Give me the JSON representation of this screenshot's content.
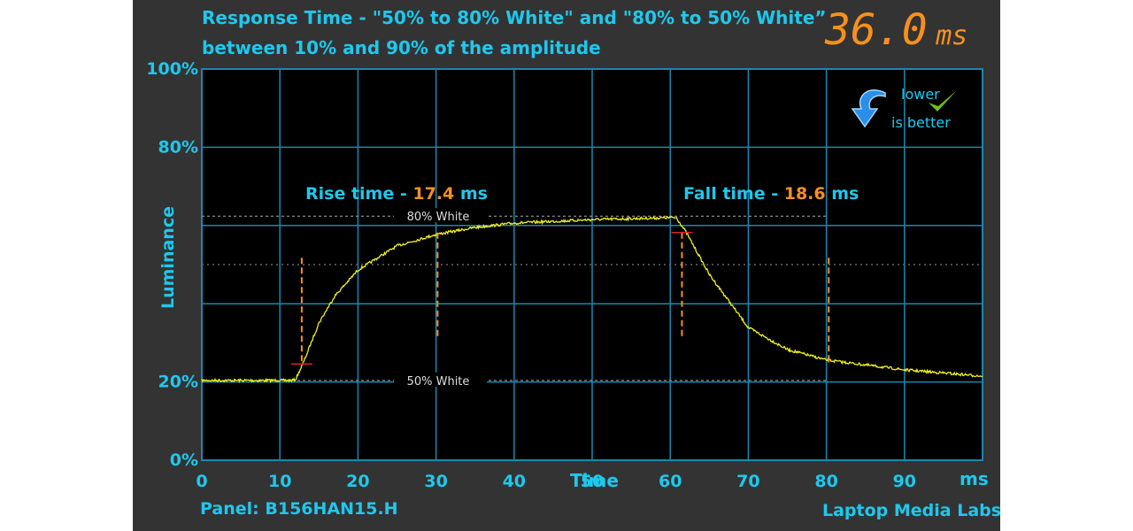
{
  "chart_data": {
    "type": "line",
    "title_line1": "Response Time - \"50% to 80% White\" and \"80% to 50% White”",
    "title_line2": "between 10% and 90% of the amplitude",
    "total": "36.0",
    "total_unit": "ms",
    "badge": {
      "line1": "lower",
      "line2": "is better"
    },
    "xlabel": "Time",
    "xunit": "ms",
    "ylabel": "Luminance",
    "xlim": [
      0,
      100
    ],
    "ylim": [
      0,
      100
    ],
    "x_ticks": [
      "0",
      "10",
      "20",
      "30",
      "40",
      "50",
      "60",
      "70",
      "80",
      "90"
    ],
    "y_ticks": [
      {
        "v": 100,
        "label": "100%"
      },
      {
        "v": 80,
        "label": "80%"
      },
      {
        "v": 20,
        "label": "20%"
      },
      {
        "v": 0,
        "label": "0%"
      }
    ],
    "grid": true,
    "rise": {
      "label": "Rise time -",
      "value": "17.4",
      "unit": "ms",
      "start": 12.8,
      "end": 30.2
    },
    "fall": {
      "label": "Fall time -",
      "value": "18.6",
      "unit": "ms",
      "start": 61.5,
      "end": 80.3
    },
    "reference_lines": [
      {
        "label": "80% White",
        "y": 62.4
      },
      {
        "label": "50% White",
        "y": 20.4
      }
    ],
    "series": [
      {
        "x": [
          0,
          11.5,
          12,
          13,
          15,
          17,
          20,
          25,
          30,
          35,
          40,
          50,
          60,
          60.8,
          62,
          65,
          70,
          75,
          80,
          90,
          100
        ],
        "y": [
          20.4,
          20.4,
          20.6,
          24.9,
          35.1,
          41.9,
          48.6,
          54.8,
          57.7,
          59.5,
          60.6,
          61.5,
          62.0,
          62.0,
          58.4,
          47.5,
          33.9,
          28.3,
          25.6,
          23.1,
          21.5
        ]
      }
    ],
    "footer_left": "Panel: B156HAN15.H",
    "footer_right": "Laptop Media Labs",
    "colors": {
      "background": "#333333",
      "plot": "#000000",
      "grid": "#1a87b0",
      "text": "#1ec8ee",
      "trace": "#f0f020",
      "accent": "#f7901e"
    }
  }
}
